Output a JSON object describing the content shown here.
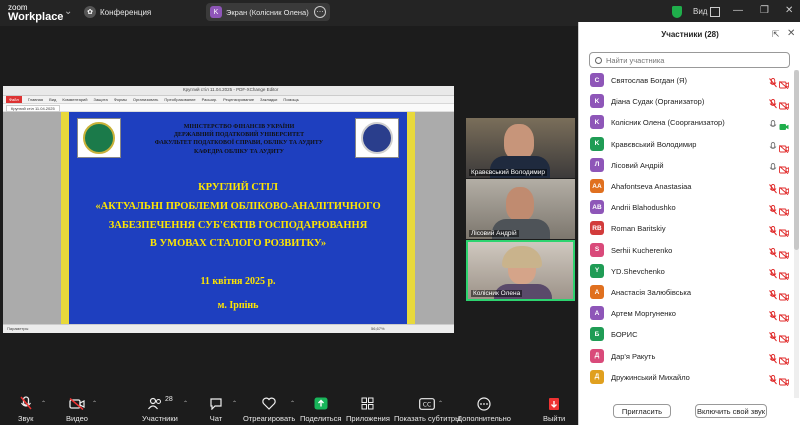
{
  "app": {
    "brand_line1": "zoom",
    "brand_line2": "Workplace"
  },
  "topbar": {
    "conference_label": "Конференция",
    "screen_badge_letter": "K",
    "screen_label": "Экран (Колісник Олена)",
    "view_label": "Вид"
  },
  "shared_window": {
    "title": "Круглий стіл 11.04.2025 - PDF-XChange Editor",
    "ribbon_tabs": [
      "Файл",
      "Главная",
      "Вид",
      "Комментарий",
      "Защита",
      "Формы",
      "Организовать",
      "Преобразование",
      "Расшир.",
      "Рецензирование",
      "Закладки",
      "Помощь"
    ],
    "doc_tab": "Круглий стіл 11.04.2025",
    "status_left": "Параметры",
    "status_zoom": "56,67%"
  },
  "slide": {
    "header_lines": [
      "МІНІСТЕРСТВО ФІНАНСІВ УКРАЇНИ",
      "ДЕРЖАВНИЙ ПОДАТКОВИЙ УНІВЕРСИТЕТ",
      "ФАКУЛЬТЕТ ПОДАТКОВОЇ СПРАВИ, ОБЛІКУ ТА АУДИТУ",
      "КАФЕДРА ОБЛІКУ ТА  АУДИТУ"
    ],
    "title_lines": [
      "КРУГЛИЙ СТІЛ",
      "«АКТУАЛЬНІ ПРОБЛЕМИ ОБЛІКОВО-АНАЛІТИЧНОГО",
      "ЗАБЕЗПЕЧЕННЯ СУБ'ЄКТІВ ГОСПОДАРЮВАННЯ",
      "В УМОВАХ СТАЛОГО РОЗВИТКУ»"
    ],
    "date": "11 квітня 2025 р.",
    "city": "м. Ірпінь"
  },
  "video_tiles": [
    {
      "name": "Кравєвський Володимир"
    },
    {
      "name": "Лісовий Андрій"
    },
    {
      "name": "Колісник Олена"
    }
  ],
  "participants_panel": {
    "title": "Участники (28)",
    "search_placeholder": "Найти участника",
    "invite_label": "Пригласить",
    "unmute_label": "Включить свой звук",
    "items": [
      {
        "letter": "С",
        "name": "Святослав Богдан (Я)",
        "color": "#8e56b8",
        "mic": "muted",
        "cam": "muted"
      },
      {
        "letter": "K",
        "name": "Діана Судак (Организатор)",
        "color": "#8e56b8",
        "mic": "muted",
        "cam": "muted"
      },
      {
        "letter": "K",
        "name": "Колісник Олена (Соорганизатор)",
        "color": "#8e56b8",
        "mic": "on",
        "cam": "on"
      },
      {
        "letter": "K",
        "name": "Кравєвський Володимир",
        "color": "#1f9c55",
        "mic": "on",
        "cam": "muted"
      },
      {
        "letter": "Л",
        "name": "Лісовий Андрій",
        "color": "#8e56b8",
        "mic": "on",
        "cam": "muted"
      },
      {
        "letter": "AA",
        "name": "Ahafontseva Anastasiaa",
        "color": "#e0701f",
        "mic": "muted",
        "cam": "muted"
      },
      {
        "letter": "AB",
        "name": "Andrii Blahodushko",
        "color": "#8e56b8",
        "mic": "muted",
        "cam": "muted"
      },
      {
        "letter": "RB",
        "name": "Roman Baritskiy",
        "color": "#d23b3b",
        "mic": "muted",
        "cam": "muted"
      },
      {
        "letter": "S",
        "name": "Serhii Kucherenko",
        "color": "#d94a7a",
        "mic": "muted",
        "cam": "muted"
      },
      {
        "letter": "Y",
        "name": "YD.Shevchenko",
        "color": "#1f9c55",
        "mic": "muted",
        "cam": "muted"
      },
      {
        "letter": "А",
        "name": "Анастасія Залюбівська",
        "color": "#e0701f",
        "mic": "muted",
        "cam": "muted"
      },
      {
        "letter": "А",
        "name": "Артем Моргуненко",
        "color": "#8e56b8",
        "mic": "muted",
        "cam": "muted"
      },
      {
        "letter": "Б",
        "name": "БОРИС",
        "color": "#1f9c55",
        "mic": "muted",
        "cam": "muted"
      },
      {
        "letter": "Д",
        "name": "Дар'я Ракуть",
        "color": "#d94a7a",
        "mic": "muted",
        "cam": "muted"
      },
      {
        "letter": "Д",
        "name": "Дружинський Михайло",
        "color": "#e0a01f",
        "mic": "muted",
        "cam": "muted"
      }
    ]
  },
  "toolbar": {
    "audio": "Звук",
    "video": "Видео",
    "participants": "Участники",
    "participants_count": "28",
    "chat": "Чат",
    "react": "Отреагировать",
    "share": "Поделиться",
    "apps": "Приложения",
    "captions": "Показать субтитры",
    "more": "Дополнительно",
    "leave": "Выйти"
  }
}
